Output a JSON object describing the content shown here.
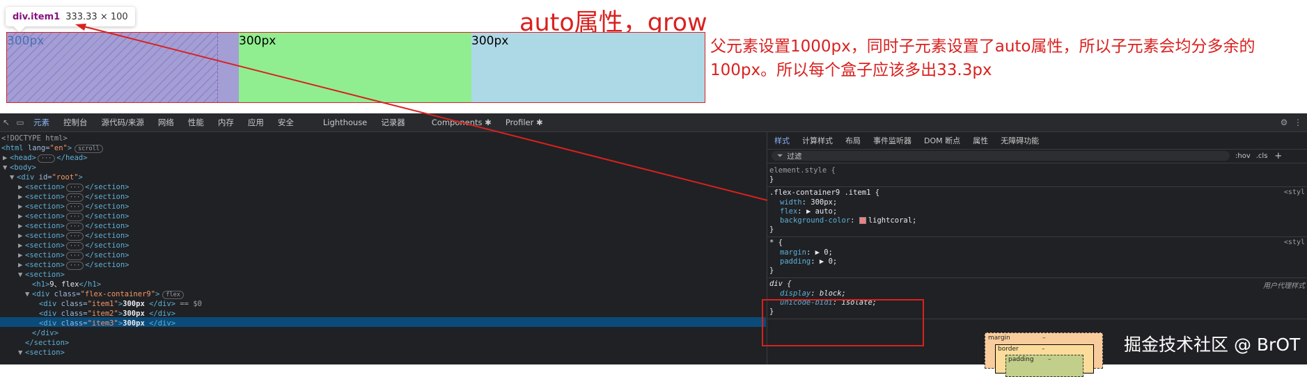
{
  "page": {
    "tooltip": {
      "name": "div.item1",
      "size": "333.33 × 100"
    },
    "title": "auto属性，grow",
    "note": "父元素设置1000px，同时子元素设置了auto属性，所以子元素会均分多余的100px。所以每个盒子应该多出33.3px",
    "items": [
      {
        "label": "300px",
        "color": "#a39ed3"
      },
      {
        "label": "300px",
        "color": "#90ee90"
      },
      {
        "label": "300px",
        "color": "#add8e6"
      }
    ],
    "annotation_color": "#d9211f"
  },
  "devtools": {
    "tabs": [
      "元素",
      "控制台",
      "源代码/来源",
      "网络",
      "性能",
      "内存",
      "应用",
      "安全",
      "Lighthouse",
      "记录器",
      "Components ✱",
      "Profiler ✱"
    ],
    "active_tab": "元素",
    "dom": {
      "doctype": "<!DOCTYPE html>",
      "html_tag": "<html",
      "html_attr": " lang=",
      "html_attr_val": "\"en\"",
      "html_close": ">",
      "scroll_pill": "scroll",
      "head": "<head>",
      "head_close": "</head>",
      "ellipsis": "···",
      "body": "<body>",
      "div_root_open": "<div",
      "div_root_attr": " id=",
      "div_root_val": "\"root\"",
      "gt": ">",
      "section_open": "<section>",
      "section_close": "</section>",
      "h1_open": "<h1>",
      "h1_text": "9、flex",
      "h1_close": "</h1>",
      "container_open": "<div",
      "class_attr": " class=",
      "container_val": "\"flex-container9\"",
      "flex_pill": "flex",
      "item1_val": "\"item1\"",
      "item2_val": "\"item2\"",
      "item3_val": "\"item3\"",
      "item_text": "300px ",
      "div_close": "</div>",
      "selected_suffix": " == $0",
      "div_close_indent": "</div>"
    },
    "styles": {
      "subtabs": [
        "样式",
        "计算样式",
        "布局",
        "事件监听器",
        "DOM 断点",
        "属性",
        "无障碍功能"
      ],
      "active_subtab": "样式",
      "filter_placeholder": "过滤",
      "filter_tools": [
        ":hov",
        ".cls",
        "+"
      ],
      "element_style": "element.style {",
      "close_brace": "}",
      "rule1_selector": ".flex-container9 .item1 {",
      "rule1_source": "<styl",
      "rule1_props": [
        {
          "name": "width",
          "value": "300px;"
        },
        {
          "name": "flex",
          "value": "▶ auto;"
        },
        {
          "name": "background-color",
          "value": "lightcoral;"
        }
      ],
      "rule2_selector": "* {",
      "rule2_source": "<styl",
      "rule2_props": [
        {
          "name": "margin",
          "value": "▶ 0;"
        },
        {
          "name": "padding",
          "value": "▶ 0;"
        }
      ],
      "rule3_selector": "div {",
      "rule3_source": "用户代理样式",
      "rule3_props": [
        {
          "name": "display",
          "value": "block;"
        },
        {
          "name": "unicode-bidi",
          "value": "isolate;"
        }
      ]
    },
    "boxmodel": {
      "margin": "margin",
      "margin_val": "–",
      "border": "border",
      "border_val": "–",
      "padding": "padding",
      "padding_val": "–"
    }
  },
  "watermark": "掘金技术社区 @ BrOT"
}
